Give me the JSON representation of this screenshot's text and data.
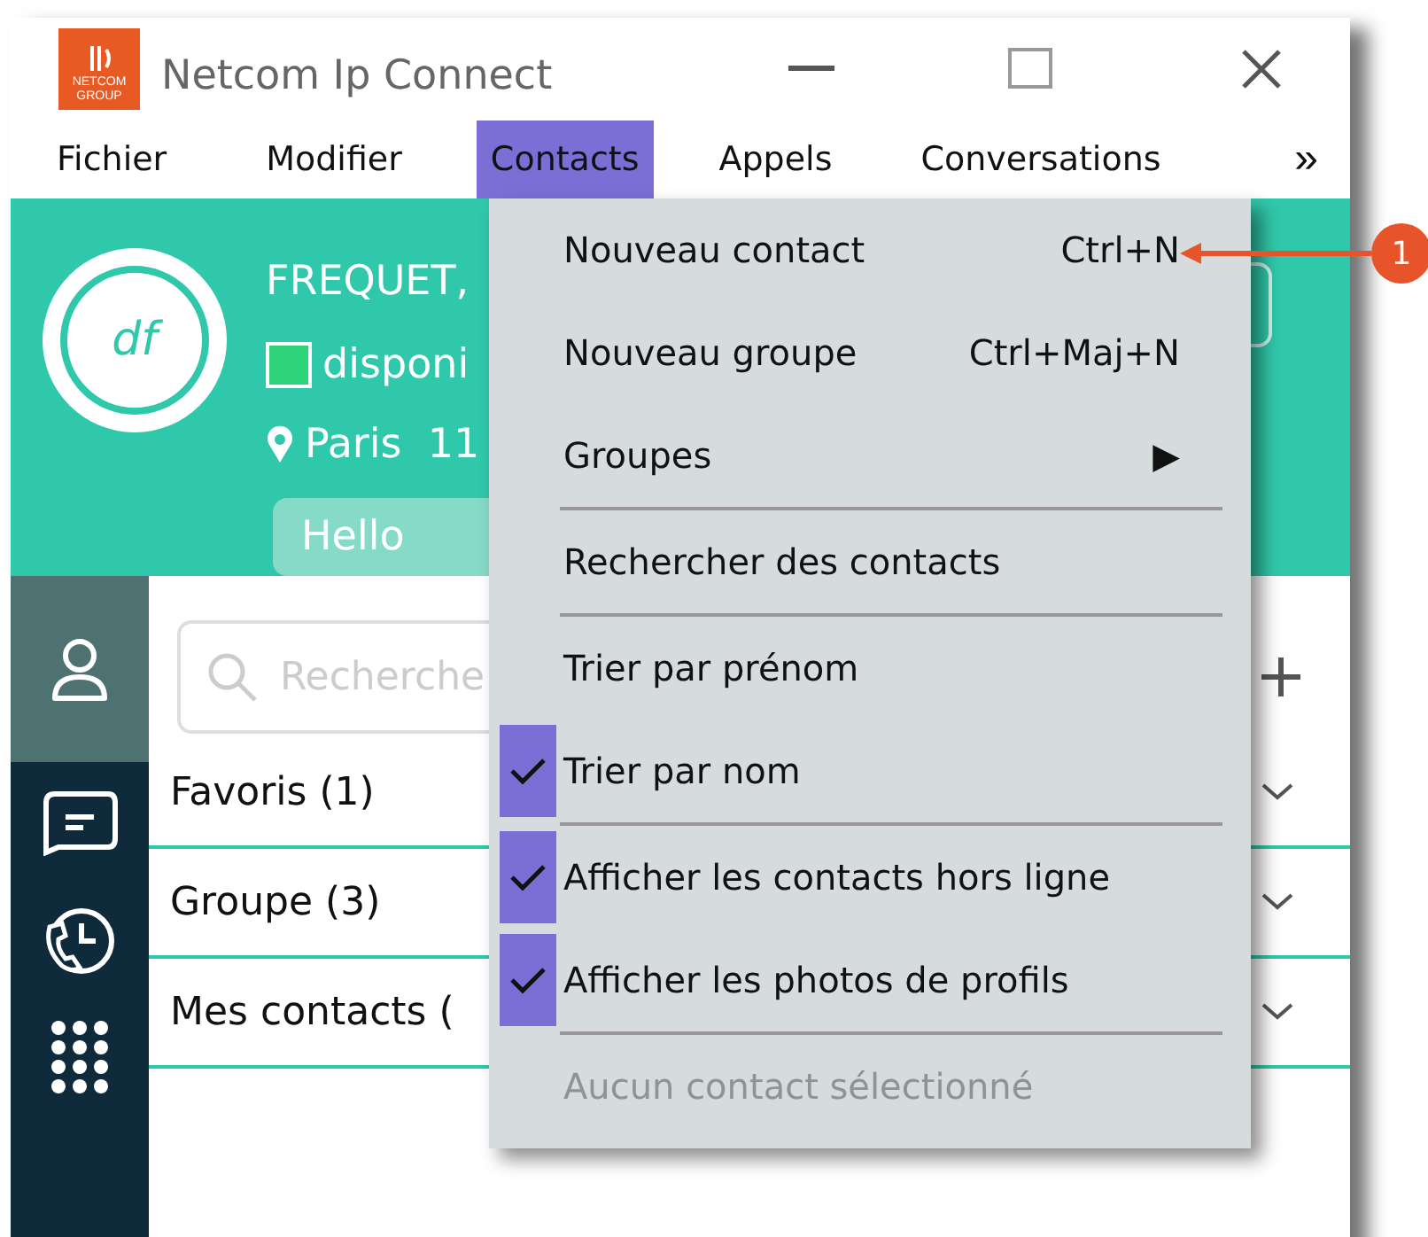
{
  "window": {
    "title": "Netcom Ip Connect",
    "logo": {
      "line_1": "NETCOM",
      "line_2": "GROUP"
    }
  },
  "menu_bar": {
    "items": [
      {
        "label": "Fichier",
        "selected": false
      },
      {
        "label": "Modifier",
        "selected": false
      },
      {
        "label": "Contacts",
        "selected": true
      },
      {
        "label": "Appels",
        "selected": false
      },
      {
        "label": "Conversations",
        "selected": false
      }
    ],
    "overflow": "»"
  },
  "profile": {
    "initials": "df",
    "name": "FREQUET,",
    "status": {
      "label": "disponi",
      "color": "#2ed47a"
    },
    "location": "Paris  11",
    "mood": "Hello"
  },
  "sidebar": {
    "items": [
      {
        "kind": "contacts",
        "selected": true
      },
      {
        "kind": "chat",
        "selected": false
      },
      {
        "kind": "history",
        "selected": false
      },
      {
        "kind": "dialpad",
        "selected": false
      }
    ]
  },
  "search": {
    "placeholder": "Recherche"
  },
  "groups": [
    {
      "label": "Favoris (1)"
    },
    {
      "label": "Groupe (3)"
    },
    {
      "label": "Mes contacts ("
    }
  ],
  "dropdown": {
    "items": [
      {
        "kind": "item",
        "label": "Nouveau contact",
        "shortcut": "Ctrl+N"
      },
      {
        "kind": "item",
        "label": "Nouveau groupe",
        "shortcut": "Ctrl+Maj+N"
      },
      {
        "kind": "submenu",
        "label": "Groupes",
        "arrow": "▶"
      },
      {
        "kind": "separator"
      },
      {
        "kind": "item",
        "label": "Rechercher des contacts"
      },
      {
        "kind": "separator"
      },
      {
        "kind": "check",
        "label": "Trier par prénom",
        "checked": false
      },
      {
        "kind": "check",
        "label": "Trier par nom",
        "checked": true
      },
      {
        "kind": "separator"
      },
      {
        "kind": "check",
        "label": "Afficher les contacts hors ligne",
        "checked": true
      },
      {
        "kind": "check",
        "label": "Afficher les photos de profils",
        "checked": true
      },
      {
        "kind": "separator"
      },
      {
        "kind": "disabled",
        "label": "Aucun contact sélectionné"
      }
    ]
  },
  "callout": {
    "number": "1"
  }
}
